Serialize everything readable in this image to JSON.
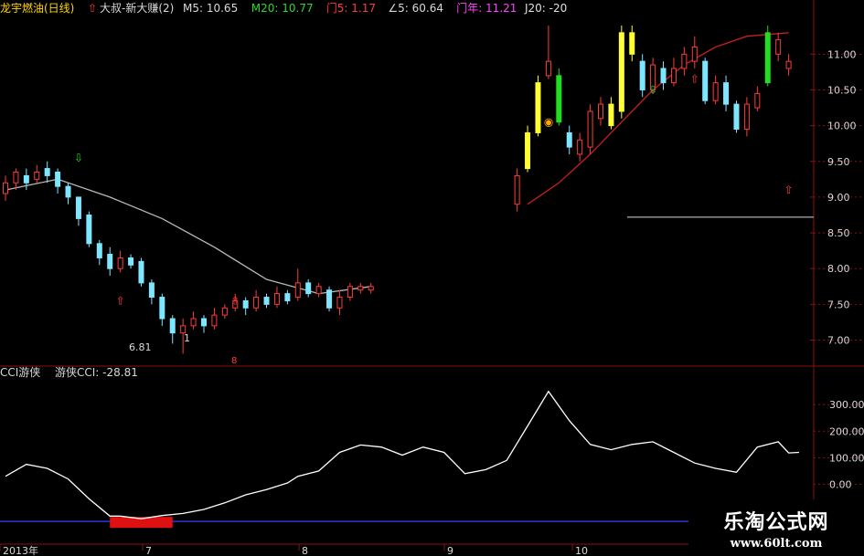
{
  "header": {
    "stock_name": "龙宇燃油(日线)",
    "indicator_name": "大叔-新大赚(2)",
    "items": [
      {
        "label": "M5: 10.65",
        "color": "#d8d8d8"
      },
      {
        "label": "M20: 10.77",
        "color": "#2fd52f"
      },
      {
        "label": "门5: 1.17",
        "color": "#ff3b3b"
      },
      {
        "label": "∠5: 60.64",
        "color": "#d8d8d8"
      },
      {
        "label": "门年: 11.21",
        "color": "#ff44ff"
      },
      {
        "label": "J20: -20",
        "color": "#e0e0e0"
      }
    ]
  },
  "cci_header": {
    "name": "CCI游侠",
    "value_label": "游侠CCI: -28.81"
  },
  "annotations": {
    "low_price": "6.81",
    "low_tick": "1",
    "mid_marker": "8"
  },
  "x_axis_labels": [
    "2013年",
    "7",
    "8",
    "9",
    "10"
  ],
  "watermark": {
    "title": "乐淘公式网",
    "url": "www.60lt.com"
  },
  "colors": {
    "up": "#ff3b3b",
    "down": "#7fe6ff",
    "yellow": "#ffff33",
    "green": "#22dd22",
    "ma_slow": "#b8b8b8",
    "ma_red": "#c81e1e",
    "grid": "#8a1212",
    "cci_line": "#ffffff",
    "baseline": "#3333dd"
  },
  "chart_data": [
    {
      "type": "candlestick",
      "title": "",
      "y_ticks": [
        11.0,
        10.5,
        10.0,
        9.5,
        9.0,
        8.5,
        8.0,
        7.5,
        7.0
      ],
      "ylim": [
        6.7,
        11.4
      ],
      "x_range": [
        0,
        152
      ],
      "reference_line": 8.72,
      "candles": [
        {
          "i": 0,
          "o": 9.05,
          "c": 9.2,
          "h": 9.3,
          "l": 8.95
        },
        {
          "i": 2,
          "o": 9.2,
          "c": 9.35,
          "h": 9.4,
          "l": 9.1
        },
        {
          "i": 4,
          "o": 9.3,
          "c": 9.2,
          "h": 9.4,
          "l": 9.1
        },
        {
          "i": 6,
          "o": 9.25,
          "c": 9.35,
          "h": 9.45,
          "l": 9.2
        },
        {
          "i": 8,
          "o": 9.4,
          "c": 9.3,
          "h": 9.5,
          "l": 9.2
        },
        {
          "i": 10,
          "o": 9.35,
          "c": 9.15,
          "h": 9.4,
          "l": 9.05
        },
        {
          "i": 12,
          "o": 9.15,
          "c": 9.0,
          "h": 9.2,
          "l": 8.9
        },
        {
          "i": 14,
          "o": 9.0,
          "c": 8.7,
          "h": 9.0,
          "l": 8.6
        },
        {
          "i": 16,
          "o": 8.75,
          "c": 8.35,
          "h": 8.8,
          "l": 8.3
        },
        {
          "i": 18,
          "o": 8.35,
          "c": 8.15,
          "h": 8.4,
          "l": 8.05
        },
        {
          "i": 20,
          "o": 8.2,
          "c": 8.0,
          "h": 8.3,
          "l": 7.9
        },
        {
          "i": 22,
          "o": 8.0,
          "c": 8.15,
          "h": 8.25,
          "l": 7.95
        },
        {
          "i": 24,
          "o": 8.15,
          "c": 8.05,
          "h": 8.2,
          "l": 8.0
        },
        {
          "i": 26,
          "o": 8.1,
          "c": 7.8,
          "h": 8.15,
          "l": 7.75
        },
        {
          "i": 28,
          "o": 7.8,
          "c": 7.6,
          "h": 7.85,
          "l": 7.5
        },
        {
          "i": 30,
          "o": 7.6,
          "c": 7.3,
          "h": 7.65,
          "l": 7.2
        },
        {
          "i": 32,
          "o": 7.3,
          "c": 7.1,
          "h": 7.35,
          "l": 6.95
        },
        {
          "i": 34,
          "o": 7.1,
          "c": 7.2,
          "h": 7.3,
          "l": 6.81
        },
        {
          "i": 36,
          "o": 7.2,
          "c": 7.3,
          "h": 7.4,
          "l": 7.15
        },
        {
          "i": 38,
          "o": 7.3,
          "c": 7.2,
          "h": 7.35,
          "l": 7.1
        },
        {
          "i": 40,
          "o": 7.2,
          "c": 7.35,
          "h": 7.45,
          "l": 7.15
        },
        {
          "i": 42,
          "o": 7.35,
          "c": 7.45,
          "h": 7.5,
          "l": 7.3
        },
        {
          "i": 44,
          "o": 7.45,
          "c": 7.55,
          "h": 7.65,
          "l": 7.4
        },
        {
          "i": 46,
          "o": 7.55,
          "c": 7.45,
          "h": 7.6,
          "l": 7.35
        },
        {
          "i": 48,
          "o": 7.45,
          "c": 7.6,
          "h": 7.7,
          "l": 7.4
        },
        {
          "i": 50,
          "o": 7.6,
          "c": 7.5,
          "h": 7.65,
          "l": 7.45
        },
        {
          "i": 52,
          "o": 7.5,
          "c": 7.65,
          "h": 7.75,
          "l": 7.45
        },
        {
          "i": 54,
          "o": 7.65,
          "c": 7.55,
          "h": 7.7,
          "l": 7.5
        },
        {
          "i": 56,
          "o": 7.6,
          "c": 7.8,
          "h": 8.0,
          "l": 7.55
        },
        {
          "i": 58,
          "o": 7.8,
          "c": 7.65,
          "h": 7.85,
          "l": 7.6
        },
        {
          "i": 60,
          "o": 7.65,
          "c": 7.75,
          "h": 7.8,
          "l": 7.6
        },
        {
          "i": 62,
          "o": 7.7,
          "c": 7.45,
          "h": 7.75,
          "l": 7.4
        },
        {
          "i": 64,
          "o": 7.45,
          "c": 7.6,
          "h": 7.7,
          "l": 7.35
        },
        {
          "i": 66,
          "o": 7.6,
          "c": 7.75,
          "h": 7.8,
          "l": 7.55
        },
        {
          "i": 68,
          "o": 7.7,
          "c": 7.75,
          "h": 7.8,
          "l": 7.65
        },
        {
          "i": 70,
          "o": 7.7,
          "c": 7.75,
          "h": 7.8,
          "l": 7.65
        },
        {
          "i": 98,
          "o": 8.9,
          "c": 9.3,
          "h": 9.4,
          "l": 8.8
        },
        {
          "i": 100,
          "o": 9.4,
          "c": 9.9,
          "h": 10.0,
          "l": 9.35,
          "color": "yellow"
        },
        {
          "i": 102,
          "o": 9.9,
          "c": 10.6,
          "h": 10.7,
          "l": 9.85,
          "color": "yellow"
        },
        {
          "i": 104,
          "o": 10.7,
          "c": 10.9,
          "h": 11.4,
          "l": 10.65
        },
        {
          "i": 106,
          "o": 10.7,
          "c": 10.05,
          "h": 10.8,
          "l": 10.0,
          "color": "green"
        },
        {
          "i": 108,
          "o": 9.9,
          "c": 9.7,
          "h": 10.0,
          "l": 9.6
        },
        {
          "i": 110,
          "o": 9.6,
          "c": 9.8,
          "h": 9.9,
          "l": 9.5
        },
        {
          "i": 112,
          "o": 9.7,
          "c": 10.2,
          "h": 10.3,
          "l": 9.6
        },
        {
          "i": 114,
          "o": 10.1,
          "c": 10.3,
          "h": 10.4,
          "l": 10.0
        },
        {
          "i": 116,
          "o": 10.3,
          "c": 10.0,
          "h": 10.4,
          "l": 9.95,
          "color": "yellow"
        },
        {
          "i": 118,
          "o": 10.2,
          "c": 11.3,
          "h": 11.4,
          "l": 10.1,
          "color": "yellow"
        },
        {
          "i": 120,
          "o": 11.0,
          "c": 11.3,
          "h": 11.4,
          "l": 10.9,
          "color": "yellow"
        },
        {
          "i": 122,
          "o": 10.9,
          "c": 10.5,
          "h": 11.0,
          "l": 10.4
        },
        {
          "i": 124,
          "o": 10.5,
          "c": 10.85,
          "h": 10.95,
          "l": 10.45
        },
        {
          "i": 126,
          "o": 10.8,
          "c": 10.6,
          "h": 10.9,
          "l": 10.5
        },
        {
          "i": 128,
          "o": 10.6,
          "c": 10.8,
          "h": 10.95,
          "l": 10.55
        },
        {
          "i": 130,
          "o": 10.8,
          "c": 11.0,
          "h": 11.1,
          "l": 10.7
        },
        {
          "i": 132,
          "o": 10.9,
          "c": 11.1,
          "h": 11.25,
          "l": 10.8
        },
        {
          "i": 134,
          "o": 10.9,
          "c": 10.35,
          "h": 10.95,
          "l": 10.3
        },
        {
          "i": 136,
          "o": 10.35,
          "c": 10.6,
          "h": 10.7,
          "l": 10.3
        },
        {
          "i": 138,
          "o": 10.6,
          "c": 10.3,
          "h": 10.7,
          "l": 10.2
        },
        {
          "i": 140,
          "o": 10.3,
          "c": 9.95,
          "h": 10.35,
          "l": 9.9
        },
        {
          "i": 142,
          "o": 9.95,
          "c": 10.3,
          "h": 10.4,
          "l": 9.85
        },
        {
          "i": 144,
          "o": 10.25,
          "c": 10.45,
          "h": 10.55,
          "l": 10.2
        },
        {
          "i": 146,
          "o": 10.6,
          "c": 11.3,
          "h": 11.4,
          "l": 10.55,
          "color": "green"
        },
        {
          "i": 148,
          "o": 11.0,
          "c": 11.2,
          "h": 11.3,
          "l": 10.9
        },
        {
          "i": 150,
          "o": 10.8,
          "c": 10.9,
          "h": 11.0,
          "l": 10.7
        }
      ],
      "ma_slow": [
        [
          0,
          9.1
        ],
        [
          10,
          9.25
        ],
        [
          20,
          9.0
        ],
        [
          30,
          8.7
        ],
        [
          40,
          8.3
        ],
        [
          50,
          7.85
        ],
        [
          60,
          7.65
        ],
        [
          70,
          7.75
        ]
      ],
      "ma_red": [
        [
          100,
          8.9
        ],
        [
          106,
          9.2
        ],
        [
          112,
          9.6
        ],
        [
          118,
          10.05
        ],
        [
          124,
          10.5
        ],
        [
          130,
          10.85
        ],
        [
          136,
          11.1
        ],
        [
          142,
          11.25
        ],
        [
          150,
          11.3
        ]
      ]
    },
    {
      "type": "line",
      "title": "CCI游侠",
      "y_ticks": [
        300,
        200,
        100,
        0
      ],
      "ylim": [
        -150,
        380
      ],
      "x_range": [
        0,
        152
      ],
      "series": [
        {
          "values": [
            [
              0,
              30
            ],
            [
              4,
              75
            ],
            [
              8,
              60
            ],
            [
              12,
              20
            ],
            [
              16,
              -55
            ],
            [
              20,
              -120
            ],
            [
              22,
              -120
            ],
            [
              26,
              -130
            ],
            [
              30,
              -118
            ],
            [
              34,
              -110
            ],
            [
              38,
              -95
            ],
            [
              42,
              -70
            ],
            [
              46,
              -40
            ],
            [
              50,
              -20
            ],
            [
              54,
              5
            ],
            [
              56,
              30
            ],
            [
              60,
              50
            ],
            [
              64,
              120
            ],
            [
              68,
              148
            ],
            [
              72,
              140
            ],
            [
              76,
              110
            ],
            [
              80,
              140
            ],
            [
              84,
              120
            ],
            [
              88,
              40
            ],
            [
              92,
              55
            ],
            [
              96,
              90
            ],
            [
              100,
              220
            ],
            [
              104,
              350
            ],
            [
              108,
              240
            ],
            [
              112,
              150
            ],
            [
              116,
              130
            ],
            [
              120,
              150
            ],
            [
              124,
              160
            ],
            [
              128,
              120
            ],
            [
              132,
              80
            ],
            [
              136,
              60
            ],
            [
              140,
              45
            ],
            [
              144,
              140
            ],
            [
              148,
              160
            ],
            [
              150,
              118
            ],
            [
              152,
              120
            ]
          ]
        }
      ],
      "highlight_band": {
        "x_start": 20,
        "x_end": 32,
        "value": -130
      }
    }
  ]
}
